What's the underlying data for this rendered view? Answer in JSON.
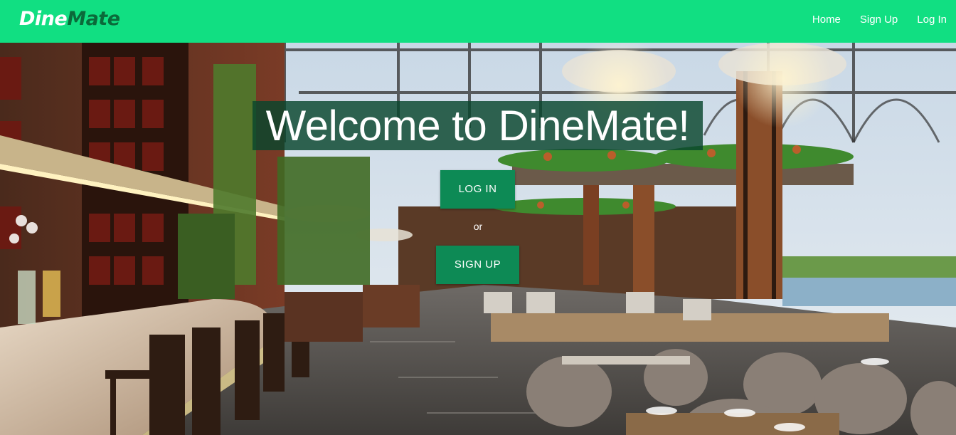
{
  "navbar": {
    "brand_part1": "Dine",
    "brand_part2": "Mate",
    "links": [
      "Home",
      "Sign Up",
      "Log In"
    ],
    "background_color": "#11df82"
  },
  "hero": {
    "background": "restaurant-interior-photo",
    "title": "Welcome to DineMate!",
    "login_label": "LOG IN",
    "or_label": "or",
    "signup_label": "SIGN UP",
    "button_color": "#0d8a55"
  }
}
